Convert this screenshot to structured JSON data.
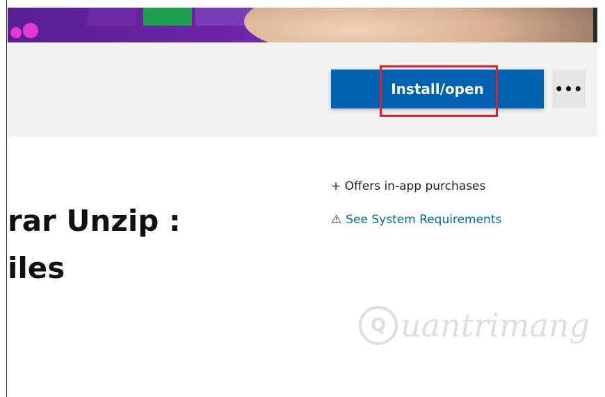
{
  "hero": {
    "dot_color": "#e23bd4"
  },
  "actions": {
    "install_label": "Install/open",
    "more_label": "•••",
    "install_color": "#0063b1",
    "highlight_color": "#e0202a"
  },
  "app": {
    "title_line1": "rar Unzip :",
    "title_line2": "iles"
  },
  "info": {
    "offers": "+ Offers in-app purchases",
    "warning_icon": "⚠",
    "sysreq_link": "See System Requirements"
  },
  "watermark": {
    "logo_glyph": "Q",
    "text": "uantrimang"
  }
}
